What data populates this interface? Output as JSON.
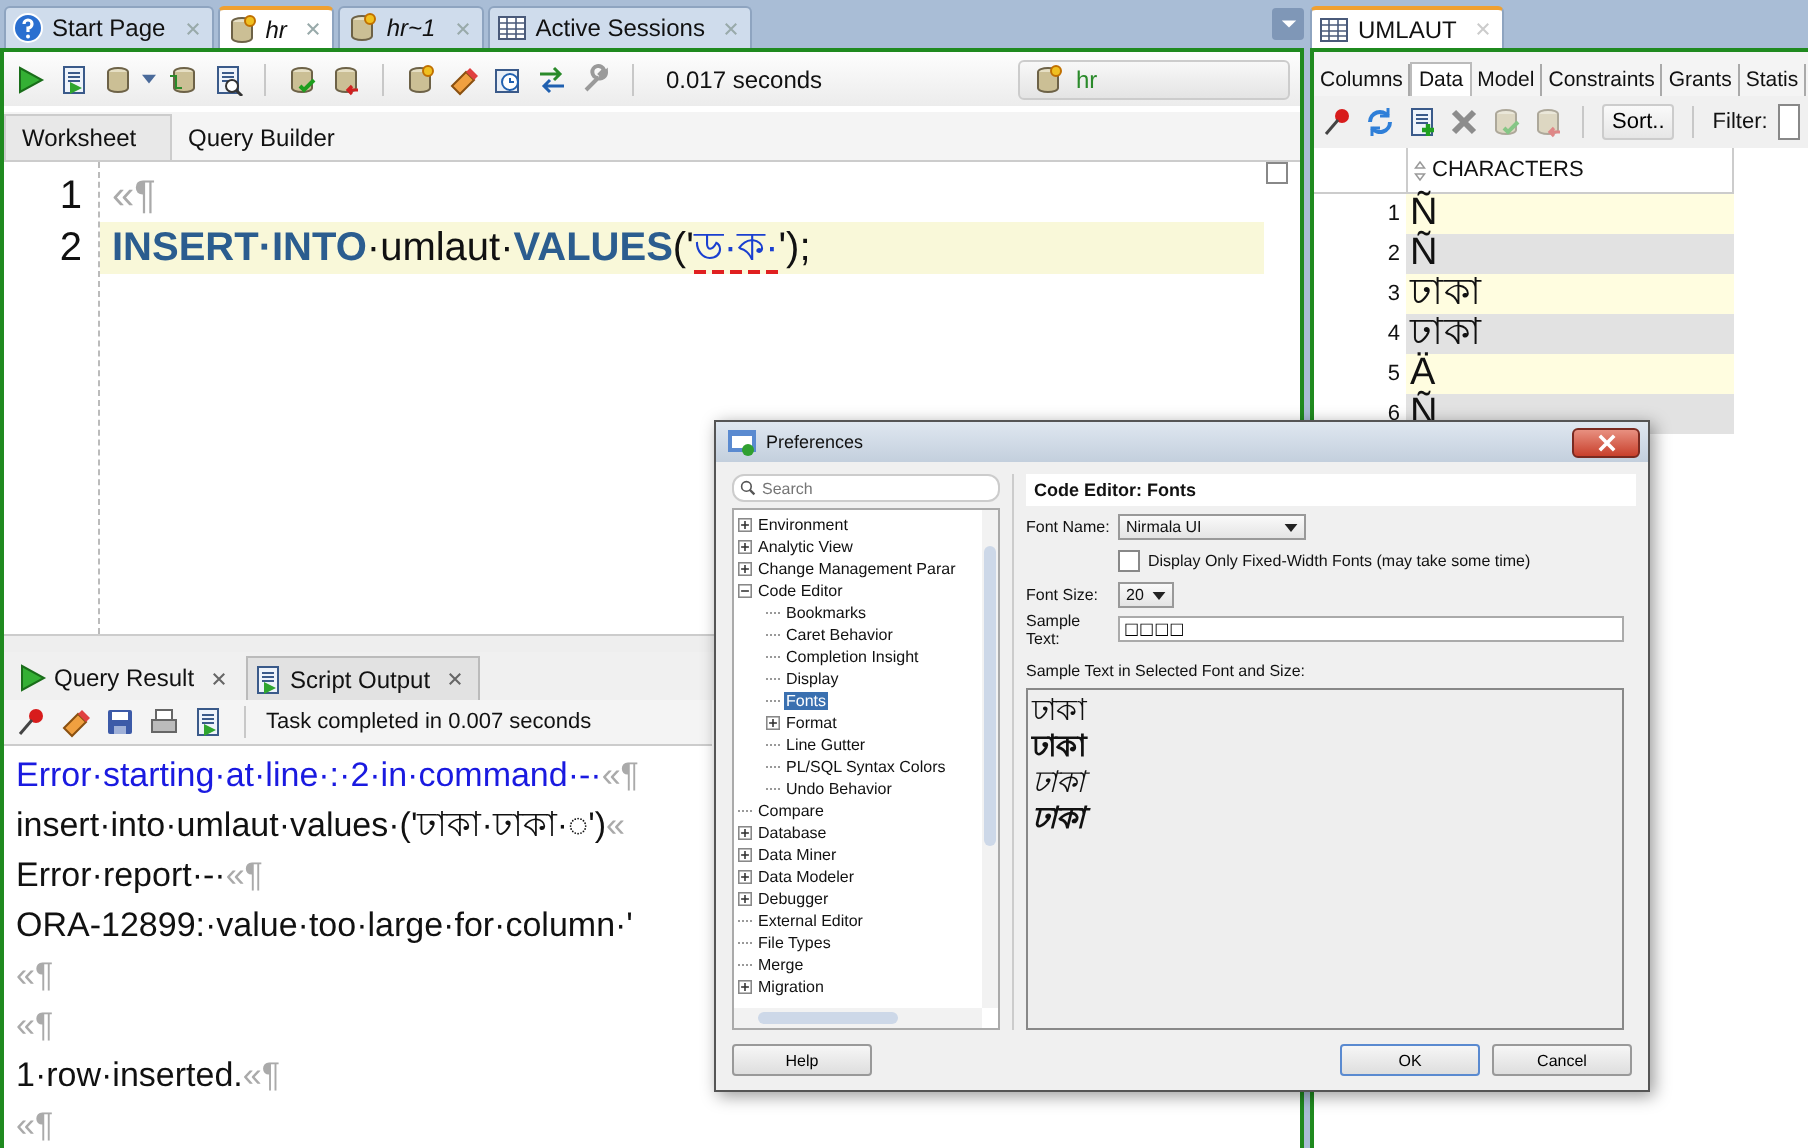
{
  "editor_tabs": [
    {
      "label": "Start Page",
      "selected": false,
      "kind": "start"
    },
    {
      "label": "hr",
      "selected": true,
      "kind": "sql"
    },
    {
      "label": "hr~1",
      "selected": false,
      "kind": "sql"
    },
    {
      "label": "Active Sessions",
      "selected": false,
      "kind": "grid"
    }
  ],
  "toolbar": {
    "elapsed": "0.017 seconds",
    "connection": "hr"
  },
  "worksheet_tabs": [
    {
      "label": "Worksheet",
      "selected": true
    },
    {
      "label": "Query Builder",
      "selected": false
    }
  ],
  "editor": {
    "lines": [
      {
        "number": "1",
        "current": false,
        "tokens": [
          {
            "kind": "marker",
            "text": "«¶"
          }
        ]
      },
      {
        "number": "2",
        "current": true,
        "tokens": [
          {
            "kind": "keyword",
            "text": "INSERT·INTO"
          },
          {
            "kind": "plain",
            "text": "·umlaut·"
          },
          {
            "kind": "keyword",
            "text": "VALUES"
          },
          {
            "kind": "plain",
            "text": "('"
          },
          {
            "kind": "error-string",
            "text": "ড·ক·"
          },
          {
            "kind": "plain",
            "text": "');"
          }
        ]
      }
    ]
  },
  "result_tabs": [
    {
      "label": "Query Result",
      "selected": false,
      "kind": "play"
    },
    {
      "label": "Script Output",
      "selected": true,
      "kind": "doc"
    }
  ],
  "result_status": "Task completed in 0.007 seconds",
  "output": [
    {
      "kind": "heading",
      "text": "Error·starting·at·line·:·2·in·command·-·",
      "end": "«¶"
    },
    {
      "kind": "plain",
      "text": "insert·into·umlaut·values·('ঢাকা·ঢাকা·◌')",
      "end": "«"
    },
    {
      "kind": "plain",
      "text": "Error·report·-·",
      "end": "«¶"
    },
    {
      "kind": "plain",
      "text": "ORA-12899:·value·too·large·for·column·'"
    },
    {
      "kind": "plain",
      "end": "«¶"
    },
    {
      "kind": "plain",
      "end": "«¶"
    },
    {
      "kind": "plain",
      "text": "1·row·inserted.",
      "end": "«¶"
    },
    {
      "kind": "plain",
      "end": "«¶"
    }
  ],
  "table": {
    "tab": "UMLAUT",
    "subtabs": [
      {
        "label": "Columns",
        "selected": false
      },
      {
        "label": "Data",
        "selected": true
      },
      {
        "label": "Model",
        "selected": false
      },
      {
        "label": "Constraints",
        "selected": false
      },
      {
        "label": "Grants",
        "selected": false
      },
      {
        "label": "Statis",
        "selected": false
      }
    ],
    "sort": "Sort..",
    "filter_label": "Filter:",
    "column": "CHARACTERS",
    "rows": [
      {
        "number": "1",
        "value": "Ñ"
      },
      {
        "number": "2",
        "value": "Ñ"
      },
      {
        "number": "3",
        "value": "ঢাকা"
      },
      {
        "number": "4",
        "value": "ঢাকা"
      },
      {
        "number": "5",
        "value": "Ä"
      },
      {
        "number": "6",
        "value": "Ñ"
      }
    ]
  },
  "dialog": {
    "title": "Preferences",
    "search_placeholder": "Search",
    "tree": [
      {
        "label": "Environment",
        "kind": "collapsed",
        "selected": false
      },
      {
        "label": "Analytic View",
        "kind": "collapsed",
        "selected": false
      },
      {
        "label": "Change Management Parar",
        "kind": "collapsed",
        "selected": false
      },
      {
        "label": "Code Editor",
        "kind": "expanded",
        "selected": false,
        "children": [
          {
            "label": "Bookmarks",
            "kind": "leaf",
            "selected": false
          },
          {
            "label": "Caret Behavior",
            "kind": "leaf",
            "selected": false
          },
          {
            "label": "Completion Insight",
            "kind": "leaf",
            "selected": false
          },
          {
            "label": "Display",
            "kind": "leaf",
            "selected": false
          },
          {
            "label": "Fonts",
            "kind": "leaf",
            "selected": true
          },
          {
            "label": "Format",
            "kind": "collapsed",
            "selected": false
          },
          {
            "label": "Line Gutter",
            "kind": "leaf",
            "selected": false
          },
          {
            "label": "PL/SQL Syntax Colors",
            "kind": "leaf",
            "selected": false
          },
          {
            "label": "Undo Behavior",
            "kind": "leaf",
            "selected": false
          }
        ]
      },
      {
        "label": "Compare",
        "kind": "leaf",
        "selected": false
      },
      {
        "label": "Database",
        "kind": "collapsed",
        "selected": false
      },
      {
        "label": "Data Miner",
        "kind": "collapsed",
        "selected": false
      },
      {
        "label": "Data Modeler",
        "kind": "collapsed",
        "selected": false
      },
      {
        "label": "Debugger",
        "kind": "collapsed",
        "selected": false
      },
      {
        "label": "External Editor",
        "kind": "leaf",
        "selected": false
      },
      {
        "label": "File Types",
        "kind": "leaf",
        "selected": false
      },
      {
        "label": "Merge",
        "kind": "leaf",
        "selected": false
      },
      {
        "label": "Migration",
        "kind": "collapsed",
        "selected": false
      }
    ],
    "help": "Help",
    "heading": "Code Editor: Fonts",
    "font_name_label": "Font Name:",
    "font_name": "Nirmala UI",
    "fixed_width": {
      "label": "Display Only Fixed-Width Fonts (may take some time)",
      "checked": false
    },
    "font_size_label": "Font Size:",
    "font_size": "20",
    "sample_label": "Sample Text:",
    "sample_text": "□□□□",
    "preview_label": "Sample Text in Selected Font and Size:",
    "preview": [
      {
        "kind": "regular",
        "text": "ঢাকা"
      },
      {
        "kind": "bold",
        "text": "ঢাকা"
      },
      {
        "kind": "italic",
        "text": "ঢাকা"
      },
      {
        "kind": "bold-italic",
        "text": "ঢাকা"
      }
    ],
    "ok": "OK",
    "cancel": "Cancel"
  }
}
